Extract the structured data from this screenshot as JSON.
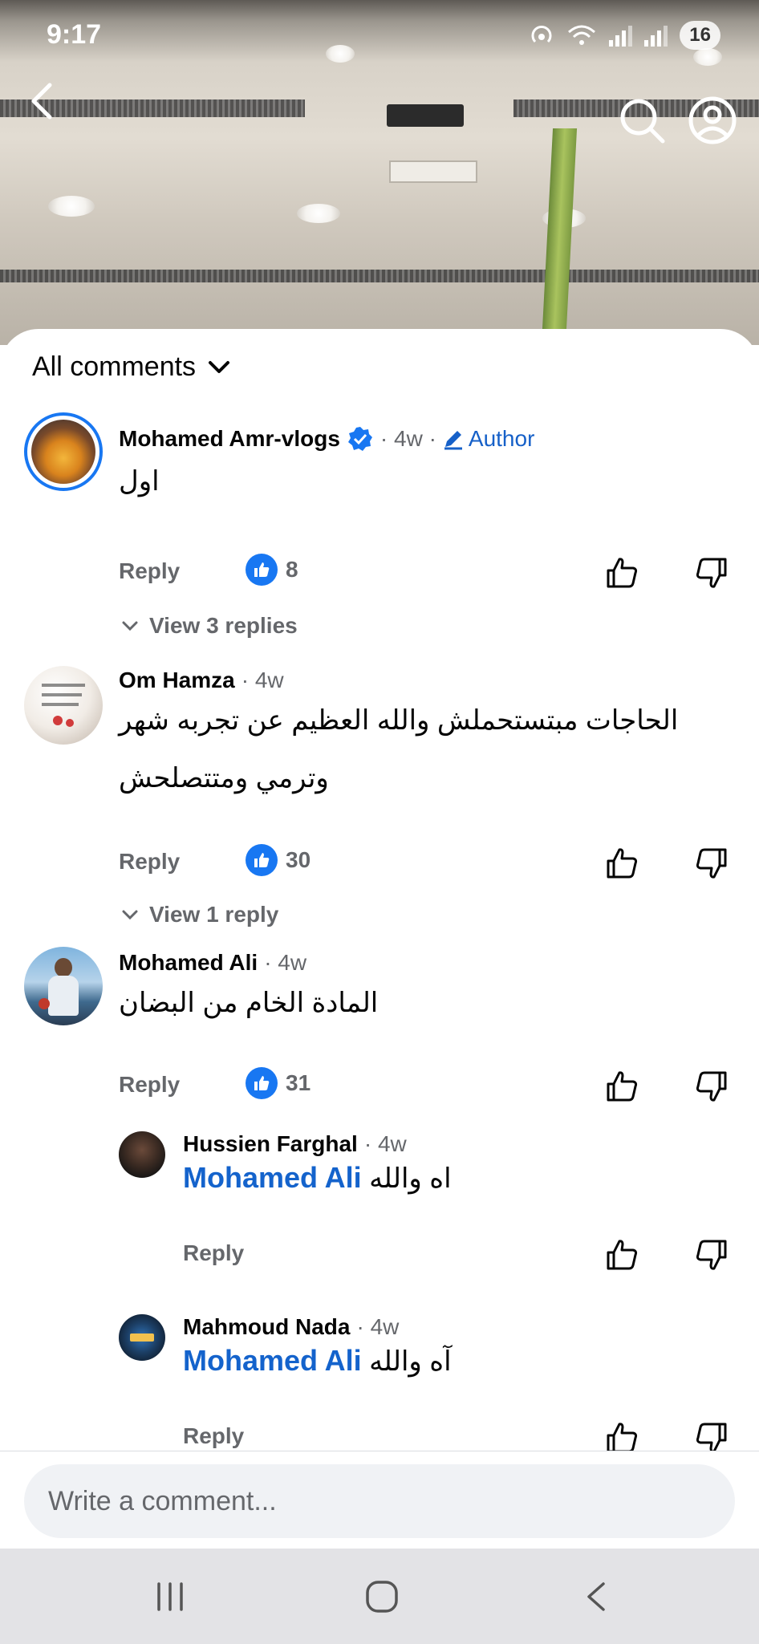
{
  "status_bar": {
    "time": "9:17",
    "battery": "16"
  },
  "sheet": {
    "header_title": "All comments"
  },
  "comments": [
    {
      "author": "Mohamed Amr-vlogs",
      "verified": true,
      "time": "· 4w ·",
      "badge": "Author",
      "text": "اول",
      "reply_label": "Reply",
      "likes": "8",
      "view_replies": "View 3 replies"
    },
    {
      "author": "Om Hamza",
      "time": "· 4w",
      "text_line1": "الحاجات مبتستحملش والله العظيم عن تجربه شهر",
      "text_line2": "وترمي ومتتصلحش",
      "reply_label": "Reply",
      "likes": "30",
      "view_replies": "View 1 reply"
    },
    {
      "author": "Mohamed Ali",
      "time": "· 4w",
      "text": "المادة الخام من البضان",
      "reply_label": "Reply",
      "likes": "31"
    }
  ],
  "replies": [
    {
      "author": "Hussien Farghal",
      "time": "· 4w",
      "mention": "Mohamed Ali",
      "text": "اه والله",
      "reply_label": "Reply"
    },
    {
      "author": "Mahmoud Nada",
      "time": "· 4w",
      "mention": "Mohamed Ali",
      "text": "آه والله",
      "reply_label": "Reply"
    }
  ],
  "compose": {
    "placeholder": "Write a comment..."
  },
  "colors": {
    "brand_blue": "#1877f2",
    "link_blue": "#1463cc",
    "meta_gray": "#65676b"
  },
  "icons": [
    "back-icon",
    "search-icon",
    "profile-icon",
    "chevron-down-icon",
    "verified-icon",
    "pencil-icon",
    "like-icon",
    "thumb-up-icon",
    "thumb-down-icon",
    "recent-apps-icon",
    "home-icon",
    "nav-back-icon"
  ]
}
